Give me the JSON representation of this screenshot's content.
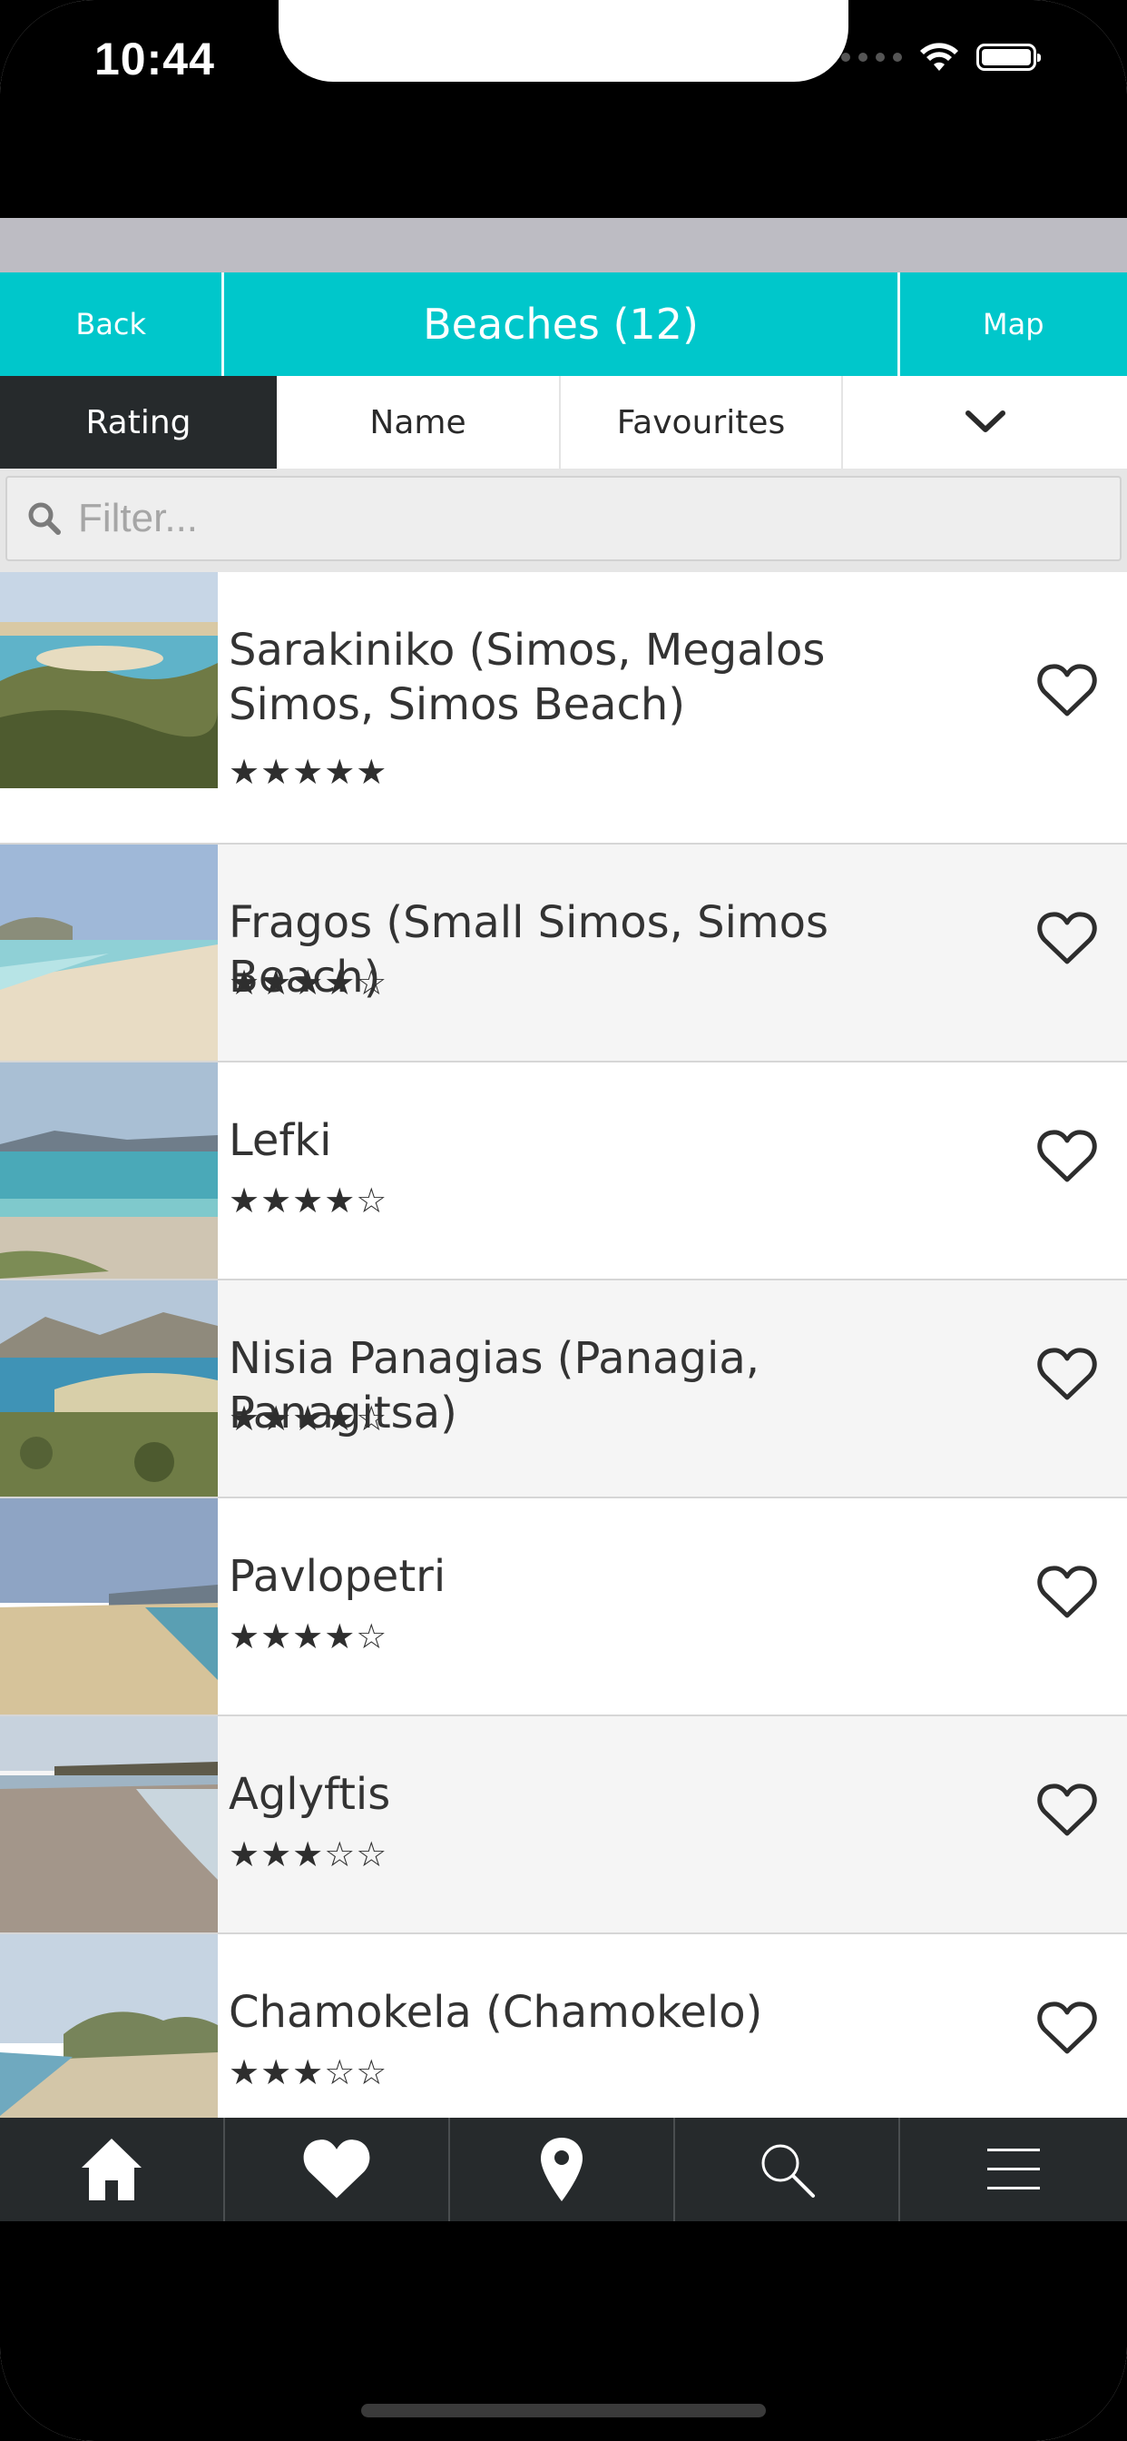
{
  "status_bar": {
    "time": "10:44"
  },
  "nav": {
    "back_label": "Back",
    "title": "Beaches (12)",
    "map_label": "Map"
  },
  "sort_tabs": [
    {
      "label": "Rating",
      "active": true
    },
    {
      "label": "Name",
      "active": false
    },
    {
      "label": "Favourites",
      "active": false
    },
    {
      "icon": "chevron-down-icon"
    }
  ],
  "filter": {
    "placeholder": "Filter...",
    "value": ""
  },
  "beaches": [
    {
      "name": "Sarakiniko (Simos, Megalos Simos, Simos Beach)",
      "stars": "★★★★★",
      "rating": 5
    },
    {
      "name": "Fragos (Small Simos, Simos Beach)",
      "stars": "★★★★☆",
      "rating": 4
    },
    {
      "name": "Lefki",
      "stars": "★★★★☆",
      "rating": 4
    },
    {
      "name": "Nisia Panagias (Panagia, Panagitsa)",
      "stars": "★★★★☆",
      "rating": 4
    },
    {
      "name": "Pavlopetri",
      "stars": "★★★★☆",
      "rating": 4
    },
    {
      "name": "Aglyftis",
      "stars": "★★★☆☆",
      "rating": 3
    },
    {
      "name": "Chamokela (Chamokelo)",
      "stars": "★★★☆☆",
      "rating": 3
    }
  ],
  "tab_bar": [
    {
      "icon": "home-icon"
    },
    {
      "icon": "heart-icon"
    },
    {
      "icon": "map-pin-icon"
    },
    {
      "icon": "search-icon"
    },
    {
      "icon": "menu-icon"
    }
  ],
  "colors": {
    "accent": "#00c7cb",
    "dark": "#262a2c"
  }
}
